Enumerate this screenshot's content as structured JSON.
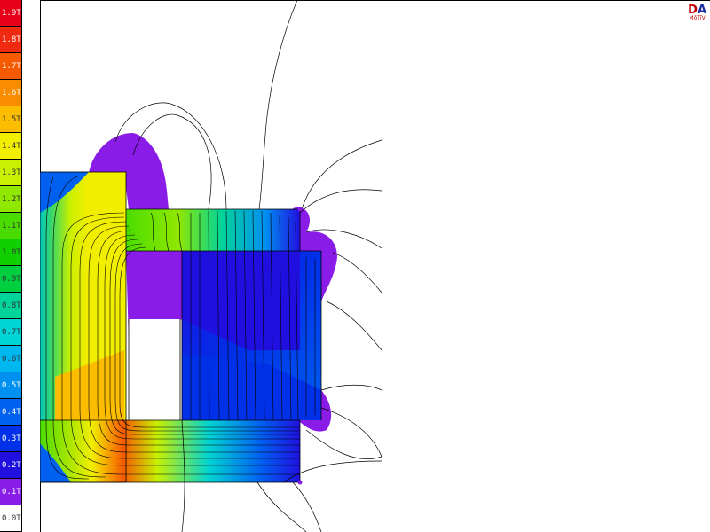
{
  "legend": {
    "levels": [
      {
        "label": "1.9T",
        "color": "#e8001a"
      },
      {
        "label": "1.8T",
        "color": "#f02a10"
      },
      {
        "label": "1.7T",
        "color": "#f65a00"
      },
      {
        "label": "1.6T",
        "color": "#fa8c00"
      },
      {
        "label": "1.5T",
        "color": "#fcbc00"
      },
      {
        "label": "1.4T",
        "color": "#f2ee00"
      },
      {
        "label": "1.3T",
        "color": "#c8f000"
      },
      {
        "label": "1.2T",
        "color": "#90e800"
      },
      {
        "label": "1.1T",
        "color": "#4adc00"
      },
      {
        "label": "1.0T",
        "color": "#10d000"
      },
      {
        "label": "0.9T",
        "color": "#00d040"
      },
      {
        "label": "0.8T",
        "color": "#00d49a"
      },
      {
        "label": "0.7T",
        "color": "#00d4d4"
      },
      {
        "label": "0.6T",
        "color": "#00b8f0"
      },
      {
        "label": "0.5T",
        "color": "#0090f0"
      },
      {
        "label": "0.4T",
        "color": "#0060f0"
      },
      {
        "label": "0.3T",
        "color": "#0030e8"
      },
      {
        "label": "0.2T",
        "color": "#2010e0"
      },
      {
        "label": "0.1T",
        "color": "#8a1ce8"
      },
      {
        "label": "0.0T",
        "color": "#ffffff"
      }
    ]
  },
  "logo": {
    "letter_d": "D",
    "letter_a": "A",
    "caption": "MōTīV"
  }
}
